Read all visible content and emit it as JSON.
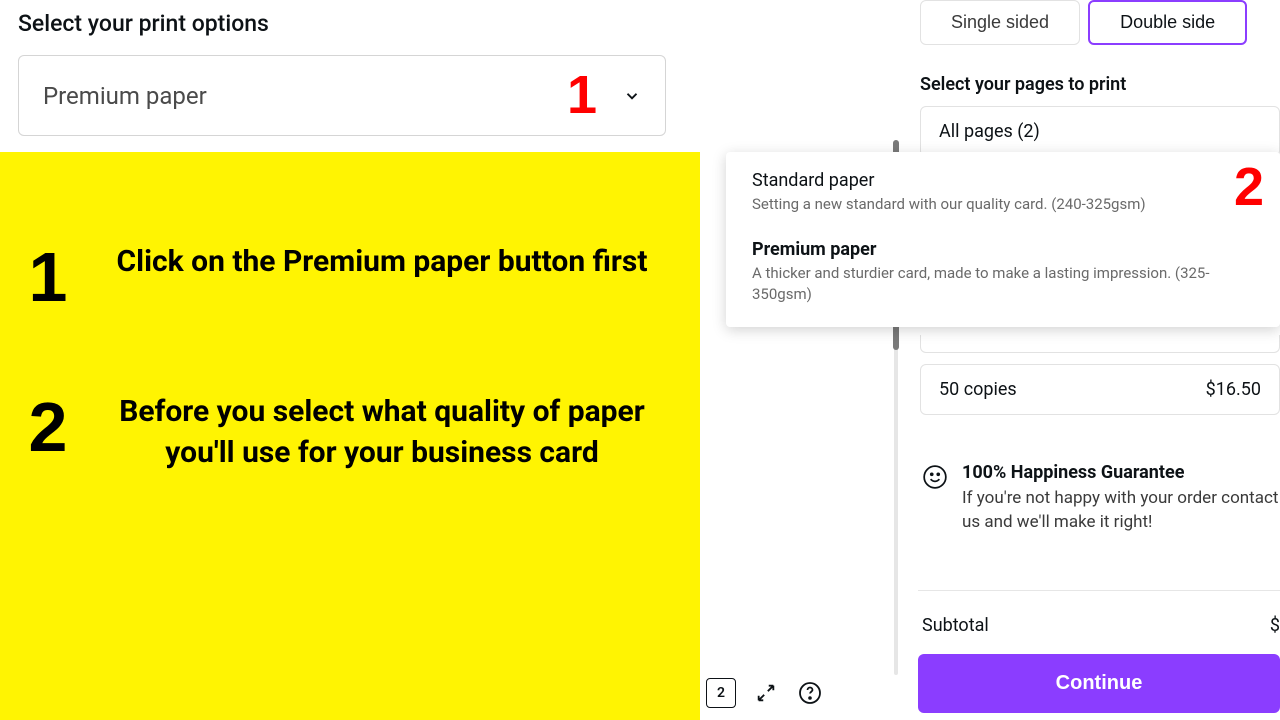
{
  "left": {
    "select_label": "Select your print options",
    "dropdown_value": "Premium paper",
    "marker1": "1"
  },
  "instructions": {
    "step1": {
      "num": "1",
      "text": "Click on the Premium paper button first"
    },
    "step2": {
      "num": "2",
      "text": "Before you select what quality of paper you'll use for your business card"
    }
  },
  "right": {
    "sided": {
      "single": "Single sided",
      "double": "Double side"
    },
    "pages_label": "Select your pages to print",
    "pages_value": "All pages (2)",
    "popup": {
      "marker2": "2",
      "option1": {
        "title": "Standard paper",
        "desc": "Setting a new standard with our quality card. (240-325gsm)"
      },
      "option2": {
        "title": "Premium paper",
        "desc": "A thicker and sturdier card, made to make a lasting impression. (325-350gsm)"
      }
    },
    "copies": {
      "qty": "50 copies",
      "price": "$16.50"
    },
    "guarantee": {
      "title": "100% Happiness Guarantee",
      "desc": "If you're not happy with your order contact us and we'll make it right!"
    },
    "subtotal_label": "Subtotal",
    "subtotal_value": "$",
    "continue": "Continue"
  },
  "tools": {
    "page_num": "2"
  }
}
